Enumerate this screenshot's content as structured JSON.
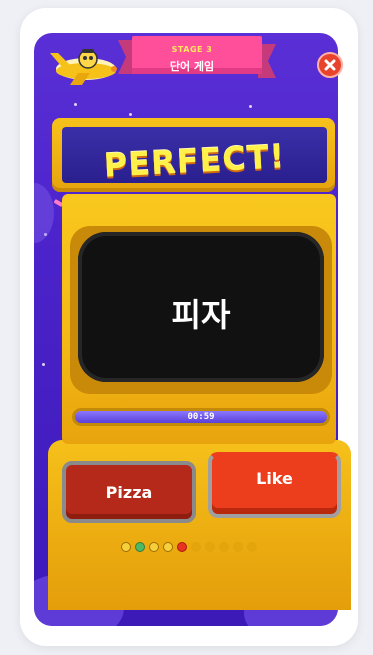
{
  "header": {
    "stage_label": "STAGE 3",
    "game_title": "단어 게임"
  },
  "result": {
    "text": "PERFECT!"
  },
  "question": {
    "word": "피자"
  },
  "timer": {
    "text": "00:59",
    "progress": 1.0
  },
  "answers": [
    {
      "label": "Pizza"
    },
    {
      "label": "Like"
    }
  ],
  "progress_dots": [
    "done",
    "wrong",
    "done",
    "done",
    "current",
    "upcoming",
    "upcoming",
    "upcoming",
    "upcoming",
    "upcoming"
  ],
  "colors": {
    "background": "#5a2fd6",
    "cabinet": "#f9c81e",
    "pizza_button": "#b5291a",
    "like_button": "#ec3d1c",
    "close_button": "#e8432c"
  },
  "icons": {
    "close": "close-icon",
    "airplane": "airplane-icon"
  }
}
